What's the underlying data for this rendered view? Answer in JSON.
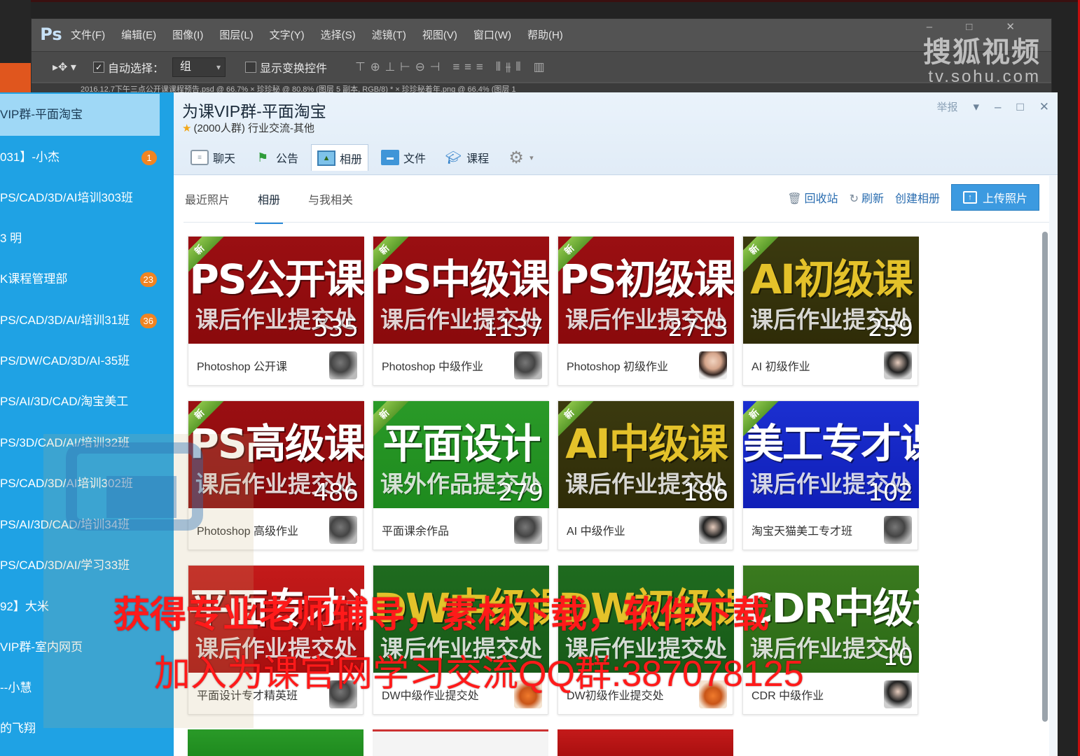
{
  "photoshop": {
    "logo": "Ps",
    "menu": [
      "文件(F)",
      "编辑(E)",
      "图像(I)",
      "图层(L)",
      "文字(Y)",
      "选择(S)",
      "滤镜(T)",
      "视图(V)",
      "窗口(W)",
      "帮助(H)"
    ],
    "auto_select_label": "自动选择：",
    "auto_select_value": "组",
    "show_transform_label": "显示变换控件",
    "tabs_text": "2016.12.7下午三点公开课课程预告.psd @ 66.7%  ×    珍珍秘 @ 80.8% (图层 5 副本, RGB/8) *  ×    珍珍秘着年.png @ 66.4% (图层 1"
  },
  "watermark": {
    "zh": "搜狐视频",
    "en": "tv.sohu.com"
  },
  "qq_list": {
    "items": [
      {
        "label": "VIP群-平面淘宝",
        "badge": ""
      },
      {
        "label": "031】-小杰",
        "badge": "1"
      },
      {
        "label": "PS/CAD/3D/AI培训303班",
        "badge": ""
      },
      {
        "label": "3  明",
        "badge": ""
      },
      {
        "label": "K课程管理部",
        "badge": "23"
      },
      {
        "label": "PS/CAD/3D/AI/培训31班",
        "badge": "36"
      },
      {
        "label": "PS/DW/CAD/3D/AI-35班",
        "badge": ""
      },
      {
        "label": "PS/AI/3D/CAD/淘宝美工",
        "badge": ""
      },
      {
        "label": "PS/3D/CAD/AI/培训32班",
        "badge": ""
      },
      {
        "label": "PS/CAD/3D/AI培训302班",
        "badge": ""
      },
      {
        "label": "PS/AI/3D/CAD/培训34班",
        "badge": ""
      },
      {
        "label": "PS/CAD/3D/AI/学习33班",
        "badge": ""
      },
      {
        "label": "92】大米",
        "badge": ""
      },
      {
        "label": "VIP群-室内网页",
        "badge": ""
      },
      {
        "label": "--小慧",
        "badge": ""
      },
      {
        "label": "的飞翔",
        "badge": ""
      }
    ]
  },
  "group": {
    "title": "为课VIP群-平面淘宝",
    "subtitle": "(2000人群) 行业交流-其他",
    "report": "举报",
    "tabs": [
      "聊天",
      "公告",
      "相册",
      "文件",
      "课程"
    ]
  },
  "album_nav": {
    "items": [
      "最近照片",
      "相册",
      "与我相关"
    ],
    "recycle": "回收站",
    "refresh": "刷新",
    "create": "创建相册",
    "upload": "上传照片"
  },
  "ribbon_label": "新",
  "albums": [
    {
      "big": "PS公开课",
      "small": "课后作业提交处",
      "count": "535",
      "name": "Photoshop 公开课"
    },
    {
      "big": "PS中级课",
      "small": "课后作业提交处",
      "count": "1137",
      "name": "Photoshop 中级作业"
    },
    {
      "big": "PS初级课",
      "small": "课后作业提交处",
      "count": "2713",
      "name": "Photoshop 初级作业"
    },
    {
      "big": "AI初级课",
      "small": "课后作业提交处",
      "count": "259",
      "name": "AI 初级作业"
    },
    {
      "big": "PS高级课",
      "small": "课后作业提交处",
      "count": "486",
      "name": "Photoshop 高级作业"
    },
    {
      "big": "平面设计",
      "small": "课外作品提交处",
      "count": "279",
      "name": "平面课余作品"
    },
    {
      "big": "AI中级课",
      "small": "课后作业提交处",
      "count": "186",
      "name": "AI 中级作业"
    },
    {
      "big": "美工专才课",
      "small": "课后作业提交处",
      "count": "102",
      "name": "淘宝天猫美工专才班"
    },
    {
      "big": "平面专才课",
      "small": "课后作业提交处",
      "count": "",
      "name": "平面设计专才精英班"
    },
    {
      "big": "DW中级课",
      "small": "课后作业提交处",
      "count": "",
      "name": "DW中级作业提交处"
    },
    {
      "big": "DW初级课",
      "small": "课后作业提交处",
      "count": "",
      "name": "DW初级作业提交处"
    },
    {
      "big": "CDR中级课",
      "small": "课后作业提交处",
      "count": "10",
      "name": "CDR 中级作业"
    }
  ],
  "promo": {
    "line1": "获得专业老师辅导，素材下载，软件下载",
    "line2": "加入为课官网学习交流QQ群:387078125"
  }
}
